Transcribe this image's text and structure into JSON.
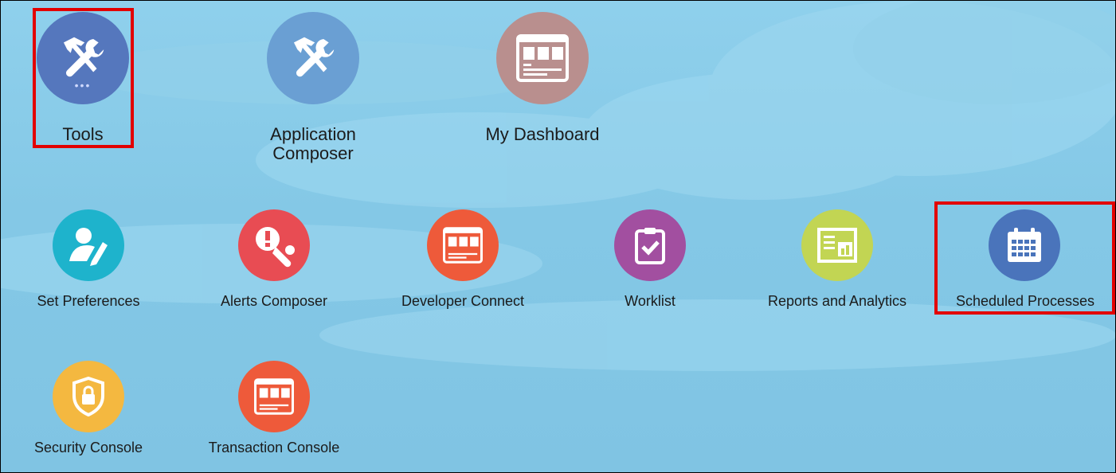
{
  "row1": [
    {
      "id": "tools",
      "label": "Tools",
      "icon": "tools-icon",
      "color": "#5577bd"
    },
    {
      "id": "app-composer",
      "label": "Application Composer",
      "label_line1": "Application",
      "label_line2": "Composer",
      "icon": "tools-icon",
      "color": "#6a9fd3"
    },
    {
      "id": "my-dashboard",
      "label": "My Dashboard",
      "icon": "dashboard-icon",
      "color": "#b98f8e"
    }
  ],
  "row2": [
    {
      "id": "set-preferences",
      "label": "Set Preferences",
      "icon": "user-edit-icon",
      "color": "#1eb3cc"
    },
    {
      "id": "alerts-composer",
      "label": "Alerts Composer",
      "icon": "alert-wrench-icon",
      "color": "#e84c53"
    },
    {
      "id": "developer-connect",
      "label": "Developer Connect",
      "icon": "dashboard-icon",
      "color": "#ee5a3a"
    },
    {
      "id": "worklist",
      "label": "Worklist",
      "icon": "clipboard-check-icon",
      "color": "#a24fa0"
    },
    {
      "id": "reports-analytics",
      "label": "Reports and Analytics",
      "icon": "report-icon",
      "color": "#c2d553"
    },
    {
      "id": "scheduled-processes",
      "label": "Scheduled Processes",
      "icon": "calendar-icon",
      "color": "#4a74bb"
    }
  ],
  "row3": [
    {
      "id": "security-console",
      "label": "Security Console",
      "icon": "shield-lock-icon",
      "color": "#f4b840"
    },
    {
      "id": "transaction-console",
      "label": "Transaction Console",
      "icon": "dashboard-icon",
      "color": "#ee5a3a"
    }
  ],
  "highlight_color": "#e20000"
}
